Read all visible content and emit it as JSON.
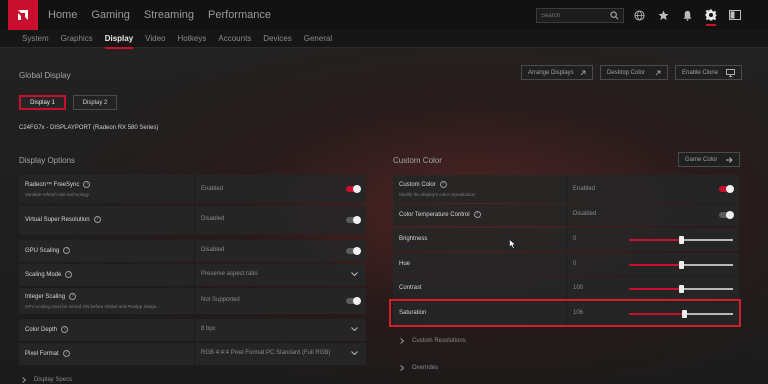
{
  "top_nav": {
    "items": [
      "Home",
      "Gaming",
      "Streaming",
      "Performance"
    ],
    "search_placeholder": "Search"
  },
  "sub_nav": {
    "items": [
      "System",
      "Graphics",
      "Display",
      "Video",
      "Hotkeys",
      "Accounts",
      "Devices",
      "General"
    ],
    "active": "Display"
  },
  "global_display": {
    "title": "Global Display",
    "buttons": {
      "arrange": "Arrange Displays",
      "desktop_color": "Desktop Color",
      "enable_clone": "Enable Clone"
    },
    "displays": [
      "Display 1",
      "Display 2"
    ],
    "selected_display": "Display 1",
    "monitor_info": "C24FG7x - DISPLAYPORT (Radeon RX 580 Series)"
  },
  "display_options": {
    "title": "Display Options",
    "rows": [
      {
        "label": "Radeon™ FreeSync",
        "sublabel": "Variable-refresh-rate technology",
        "value": "Enabled",
        "control": "toggle-on"
      },
      {
        "label": "Virtual Super Resolution",
        "sublabel": "",
        "value": "Disabled",
        "control": "toggle-off"
      },
      {
        "label": "GPU Scaling",
        "sublabel": "",
        "value": "Disabled",
        "control": "toggle-off"
      },
      {
        "label": "Scaling Mode",
        "sublabel": "",
        "value": "Preserve aspect ratio",
        "control": "dropdown"
      },
      {
        "label": "Integer Scaling",
        "sublabel": "GPU scaling must be turned ON before Global and Pixelpp Intege...",
        "value": "Not Supported",
        "control": "toggle-off"
      },
      {
        "label": "Color Depth",
        "sublabel": "",
        "value": "8 bpc",
        "control": "dropdown"
      },
      {
        "label": "Pixel Format",
        "sublabel": "",
        "value": "RGB 4:4:4 Pixel Format PC Standard (Full RGB)",
        "control": "dropdown"
      }
    ],
    "footer_item": "Display Specs"
  },
  "custom_color": {
    "title": "Custom Color",
    "game_color_button": "Game Color",
    "rows": [
      {
        "label": "Custom Color",
        "sublabel": "Modify the display's color reproduction",
        "value": "Enabled",
        "control": "toggle-on"
      },
      {
        "label": "Color Temperature Control",
        "sublabel": "",
        "value": "Disabled",
        "control": "toggle-off"
      },
      {
        "label": "Brightness",
        "value": "0",
        "control": "slider",
        "level": 0.5
      },
      {
        "label": "Hue",
        "value": "0",
        "control": "slider",
        "level": 0.5
      },
      {
        "label": "Contrast",
        "value": "100",
        "control": "slider",
        "level": 0.5
      },
      {
        "label": "Saturation",
        "value": "106",
        "control": "slider",
        "level": 0.53
      }
    ],
    "collapsibles": [
      "Custom Resolutions",
      "Overrides"
    ]
  },
  "colors": {
    "accent": "#c8102e",
    "highlight": "#d2202a"
  }
}
